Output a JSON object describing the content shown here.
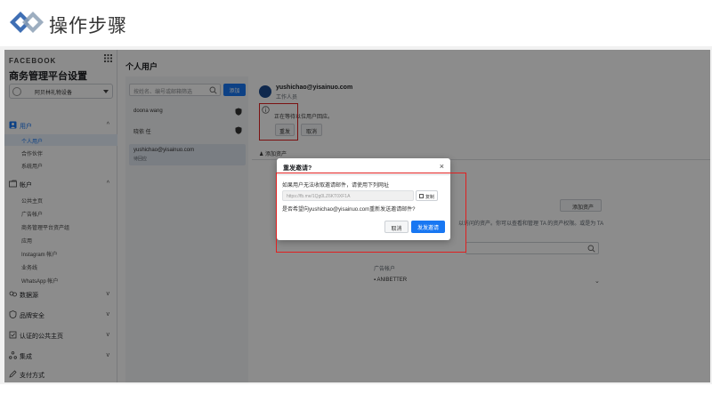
{
  "header": {
    "title": "操作步骤"
  },
  "sidebar": {
    "brand": "FACEBOOK",
    "title": "商务管理平台设置",
    "business_name": "阿贝林礼物设备",
    "sections": [
      {
        "label": "用户",
        "chevron": "^"
      },
      {
        "label": "帐户",
        "chevron": "^"
      },
      {
        "label": "数据源",
        "chevron": "v"
      },
      {
        "label": "品牌安全",
        "chevron": "v"
      },
      {
        "label": "认证的公共主页",
        "chevron": "v"
      },
      {
        "label": "集成",
        "chevron": "v"
      },
      {
        "label": "支付方式"
      }
    ],
    "user_items": [
      "个人用户",
      "合作伙伴",
      "系统用户"
    ],
    "account_items": [
      "公共主页",
      "广告帐户",
      "商务管理平台资产组",
      "应用",
      "Instagram 帐户",
      "业务线",
      "WhatsApp 帐户"
    ]
  },
  "main": {
    "title": "个人用户",
    "search_placeholder": "按姓名、编号或邮箱筛选",
    "add_label": "添加",
    "users": [
      {
        "name": "doona wang"
      },
      {
        "name": "晓依 任"
      },
      {
        "name": "yushichao@yisainuo.com",
        "status": "待回应"
      }
    ]
  },
  "detail": {
    "email": "yushichao@yisainuo.com",
    "role": "工作人员",
    "pending_text": "正在等待以位用户回应。",
    "resend_label": "重发",
    "cancel_label": "取消",
    "tab_add_assets": "添加资产",
    "add_asset_button": "添加资产",
    "desc_partial": "以访问的资产。你可以查看和管理 TA 的资产权限。或是为 TA",
    "desc_partial2": "",
    "category": "广告帐户",
    "asset_name": "ANIBETTER"
  },
  "dialog": {
    "title": "重发邀请?",
    "close": "×",
    "description": "如果用户无法收取邀请邮件，请使用下列网址",
    "link": "https://fb.me/1Qg0LZ6KT0XF1A",
    "copy_label": "复制",
    "question": "是否希望向yushichao@yisainuo.com重新发送邀请邮件?",
    "cancel_label": "取消",
    "resend_label": "发发邀请"
  }
}
